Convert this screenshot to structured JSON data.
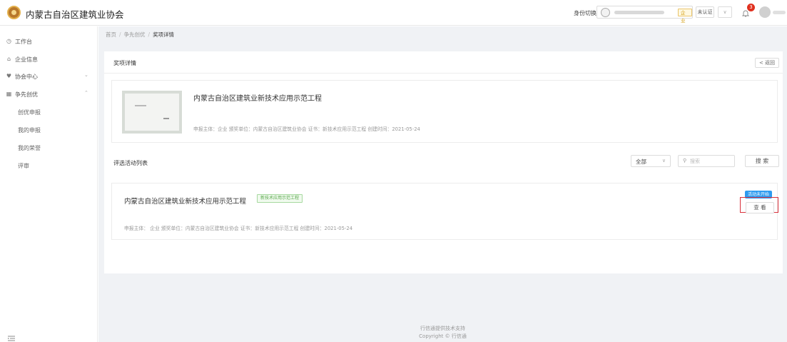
{
  "header": {
    "app_title": "内蒙古自治区建筑业协会",
    "identity_label": "身份切换:",
    "identity_tag": "企业",
    "auth_label": "未认证",
    "notification_count": "3"
  },
  "sidebar": {
    "items": [
      {
        "label": "工作台",
        "icon": "dashboard-icon"
      },
      {
        "label": "企业信息",
        "icon": "building-icon"
      },
      {
        "label": "协会中心",
        "icon": "heart-icon"
      },
      {
        "label": "争先创优",
        "icon": "grid-icon"
      }
    ],
    "sub_items": [
      {
        "label": "创优申报"
      },
      {
        "label": "我的申报"
      },
      {
        "label": "我的荣誉"
      },
      {
        "label": "评审"
      }
    ]
  },
  "breadcrumb": {
    "home": "首页",
    "parent": "争先创优",
    "current": "奖项详情"
  },
  "detail": {
    "section_title": "奖项详情",
    "back_label": "返回",
    "award_title": "内蒙古自治区建筑业新技术应用示范工程",
    "award_meta": "申报主体：企业 颁奖单位：内蒙古自治区建筑业协会 证书：新技术应用示范工程 创建时间：2021-05-24"
  },
  "activity_list": {
    "section_title": "评选活动列表",
    "filter_value": "全部",
    "search_placeholder": "搜索",
    "search_button": "搜 索",
    "items": [
      {
        "title": "内蒙古自治区建筑业新技术应用示范工程",
        "tag": "新技术应用示范工程",
        "status": "活动未开始",
        "view_label": "查 看",
        "meta": "申报主体： 企业  颁奖单位：内蒙古自治区建筑业协会  证书：新技术应用示范工程 创建时间：2021-05-24"
      }
    ]
  },
  "footer": {
    "line1": "行信通提供技术支持",
    "line2": "Copyright © 行信通"
  },
  "colors": {
    "accent_blue": "#2d9bf0",
    "badge_red": "#e0301e",
    "highlight_red": "#d9313b",
    "tag_green": "#5aa84d"
  }
}
